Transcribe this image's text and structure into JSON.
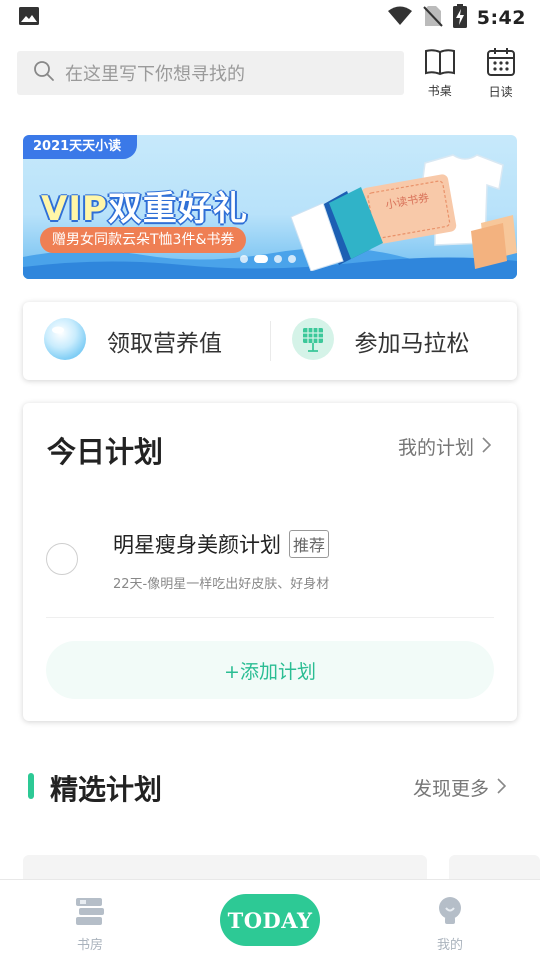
{
  "status_bar": {
    "time": "5:42",
    "icons": [
      "image-icon",
      "wifi-icon",
      "no-sim-icon",
      "battery-charging-icon"
    ]
  },
  "search": {
    "placeholder": "在这里写下你想寻找的"
  },
  "top_actions": {
    "bookshelf_label": "书桌",
    "daily_label": "日读"
  },
  "banner": {
    "tag": "2021天天小读",
    "title_vip": "VIP",
    "title_rest": "双重好礼",
    "subtitle": "赠男女同款云朵T恤3件&书券",
    "ticket_text": "小读书券",
    "dots_total": 4,
    "active_dot": 1
  },
  "quick_actions": {
    "nutrition_label": "领取营养值",
    "marathon_label": "参加马拉松"
  },
  "today_plan": {
    "title": "今日计划",
    "my_plans_label": "我的计划",
    "item": {
      "name": "明星瘦身美颜计划",
      "badge": "推荐",
      "description": "22天-像明星一样吃出好皮肤、好身材"
    },
    "add_label": "+添加计划"
  },
  "featured": {
    "title": "精选计划",
    "more_label": "发现更多"
  },
  "bottom_nav": {
    "study_label": "书房",
    "today_label": "TODAY",
    "mine_label": "我的"
  },
  "colors": {
    "accent": "#2dc995",
    "banner_blue": "#3b79e8",
    "banner_orange": "#ef7f54"
  }
}
